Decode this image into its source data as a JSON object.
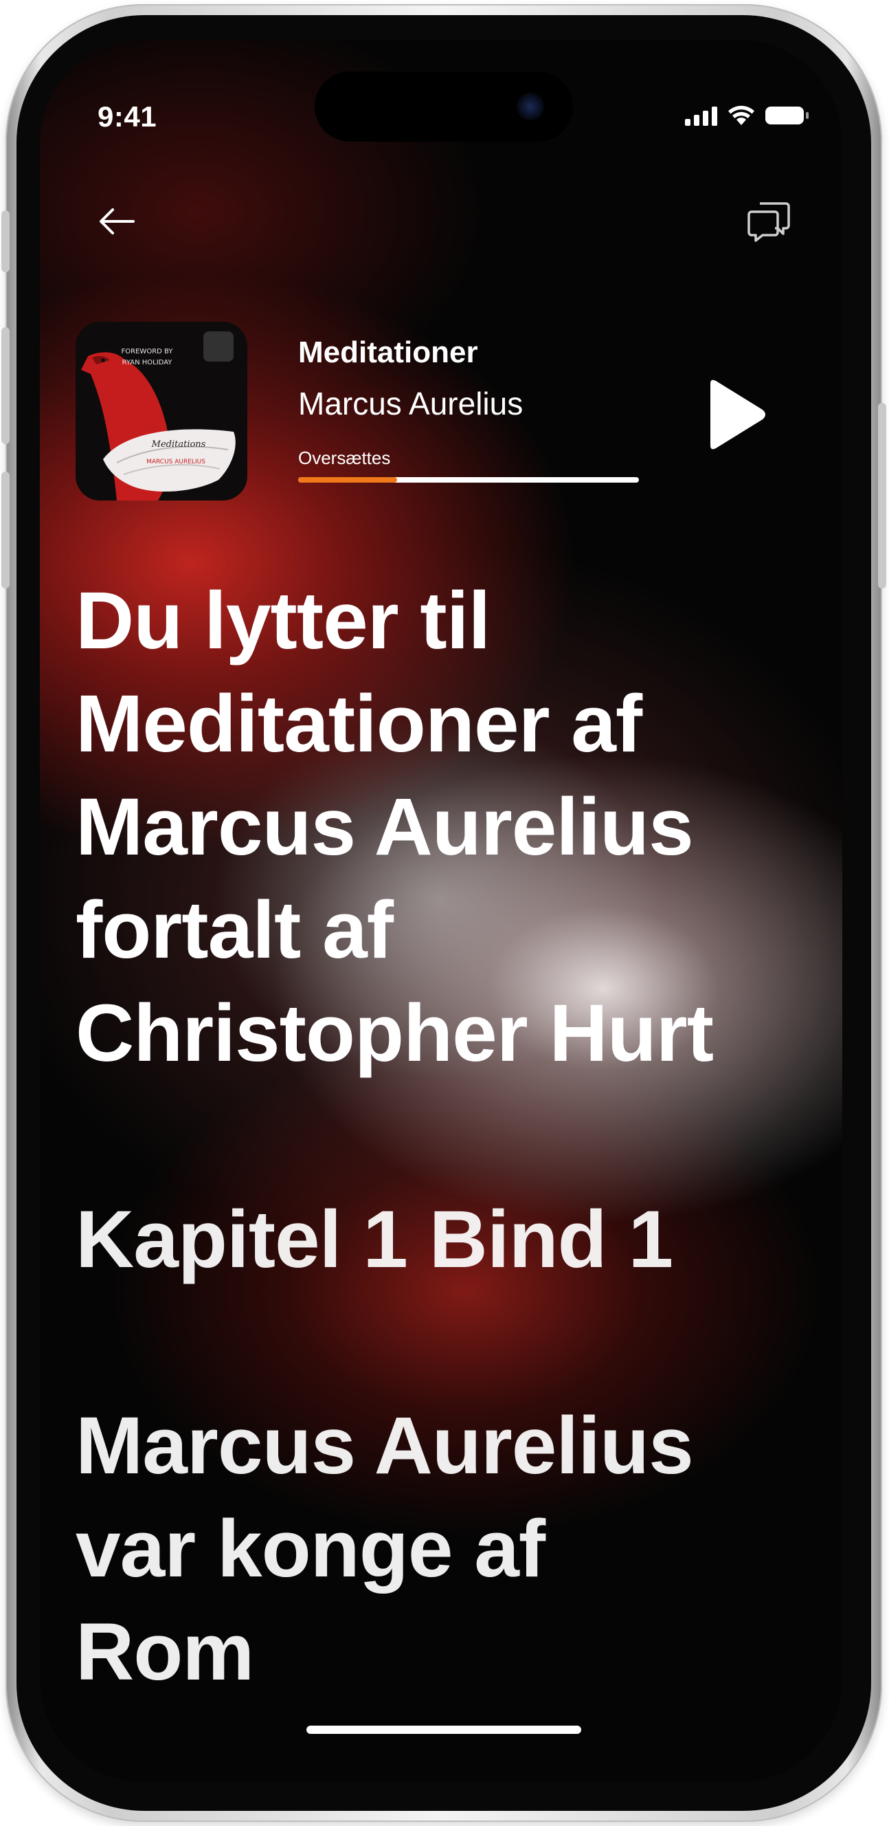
{
  "status_bar": {
    "time": "9:41"
  },
  "nav": {
    "back_icon": "arrow-left-icon",
    "chat_icon": "chat-bubbles-icon"
  },
  "now_playing": {
    "title": "Meditationer",
    "author": "Marcus Aurelius",
    "status": "Oversættes",
    "progress": 0.29,
    "accent_color": "#f07a1a",
    "cover": {
      "top_text_1": "FOREWORD BY",
      "top_text_2": "RYAN HOLIDAY",
      "book_title": "Meditations",
      "book_author": "MARCUS AURELIUS"
    }
  },
  "reading": {
    "intro_lines": [
      "Du lytter til",
      "Meditationer af",
      "Marcus Aurelius",
      "fortalt af",
      "Christopher Hurt"
    ],
    "chapter": "Kapitel 1 Bind 1",
    "body_lines": [
      "Marcus Aurelius",
      "var konge af",
      "Rom"
    ]
  },
  "colors": {
    "background": "#050505",
    "red_glow": "#c82620",
    "text": "#ffffff"
  }
}
